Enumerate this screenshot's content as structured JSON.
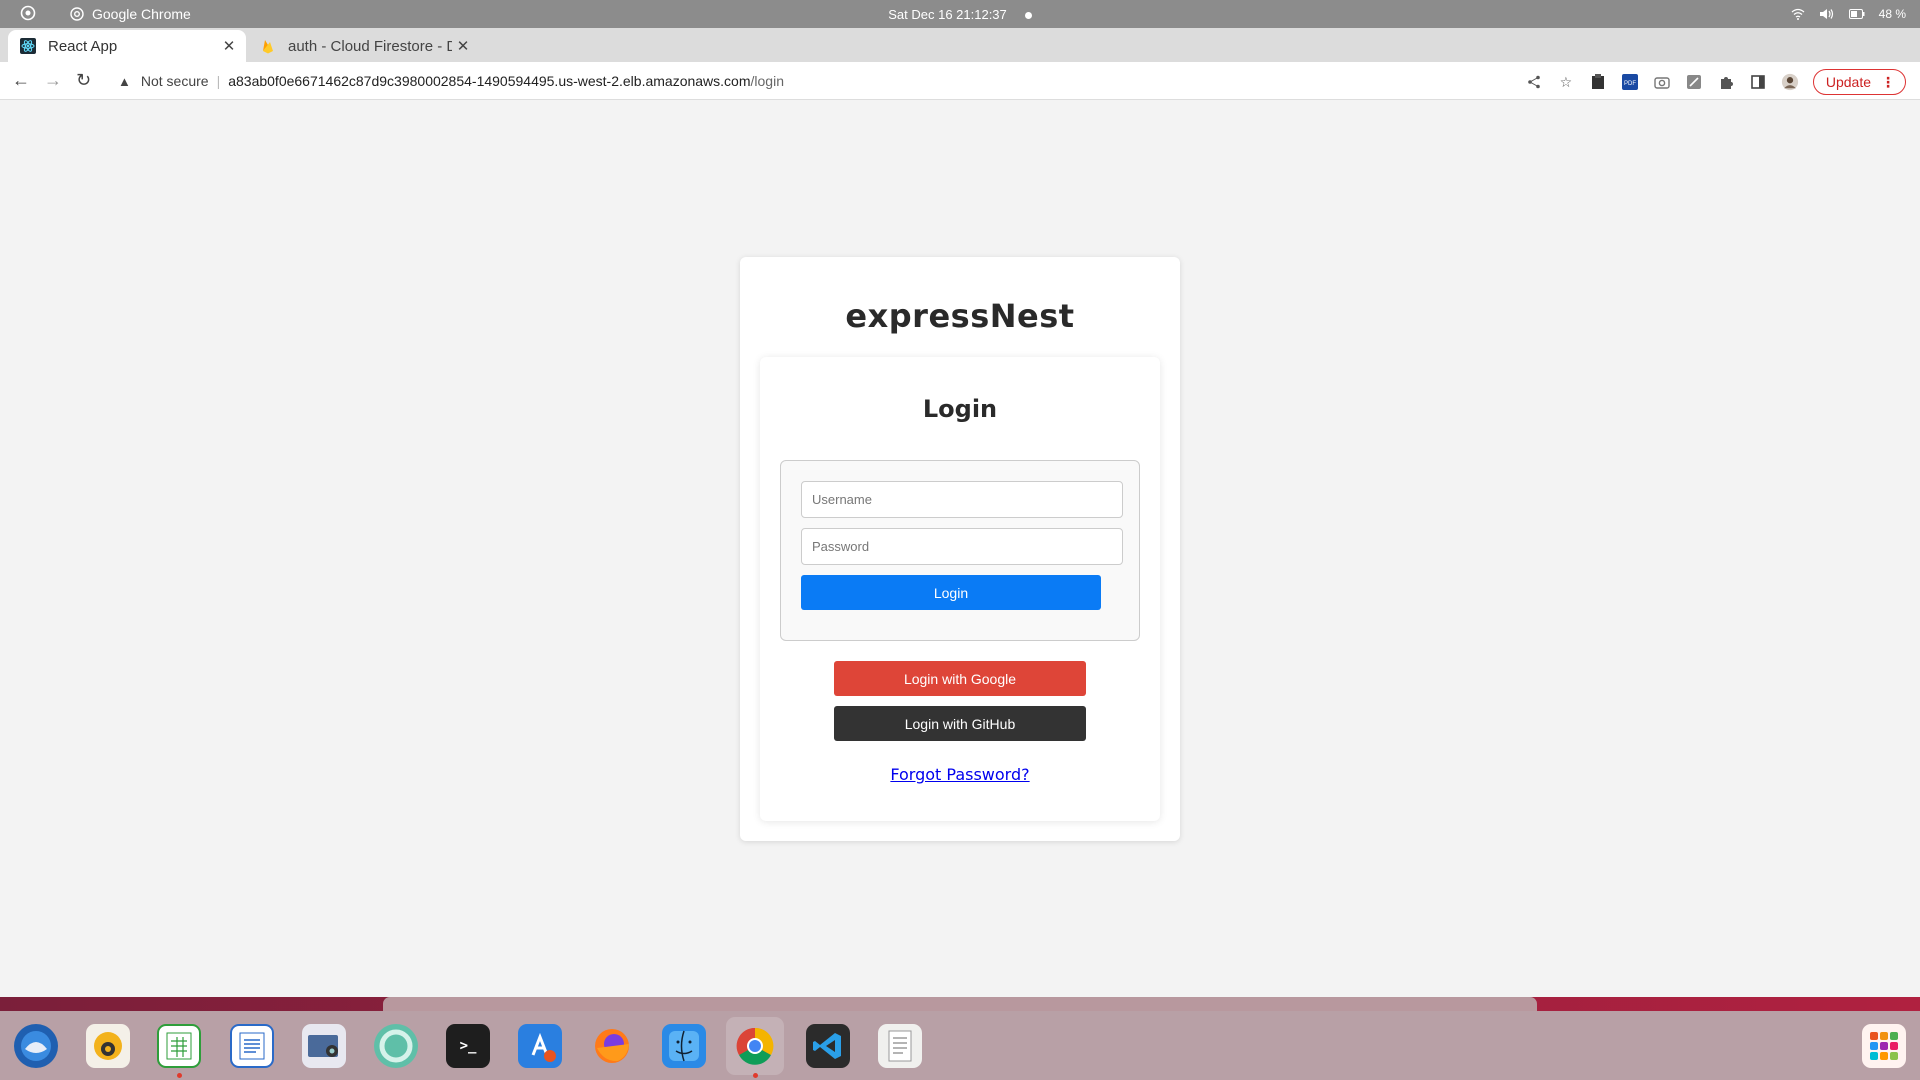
{
  "system": {
    "app_name": "Google Chrome",
    "clock": "Sat Dec 16  21:12:37",
    "battery": "48 %"
  },
  "tabs": [
    {
      "title": "React App",
      "active": true
    },
    {
      "title": "auth - Cloud Firestore - Da",
      "active": false
    }
  ],
  "toolbar": {
    "security_label": "Not secure",
    "url_host": "a83ab0f0e6671462c87d9c3980002854-1490594495.us-west-2.elb.amazonaws.com",
    "url_path": "/login",
    "update_label": "Update"
  },
  "page": {
    "brand": "expressNest",
    "login_title": "Login",
    "username_placeholder": "Username",
    "password_placeholder": "Password",
    "login_button": "Login",
    "google_button": "Login with Google",
    "github_button": "Login with GitHub",
    "forgot_link": "Forgot Password?"
  },
  "colors": {
    "login_button": "#0a7bf5",
    "google_button": "#de4538",
    "github_button": "#333333",
    "link": "#0000ee"
  },
  "dock": {
    "apps": [
      "thunderbird",
      "rhythmbox",
      "libreoffice-calc",
      "libreoffice-writer",
      "screenshot",
      "help",
      "terminal",
      "app-center",
      "firefox",
      "finder",
      "chrome",
      "vscode",
      "text-editor"
    ]
  }
}
